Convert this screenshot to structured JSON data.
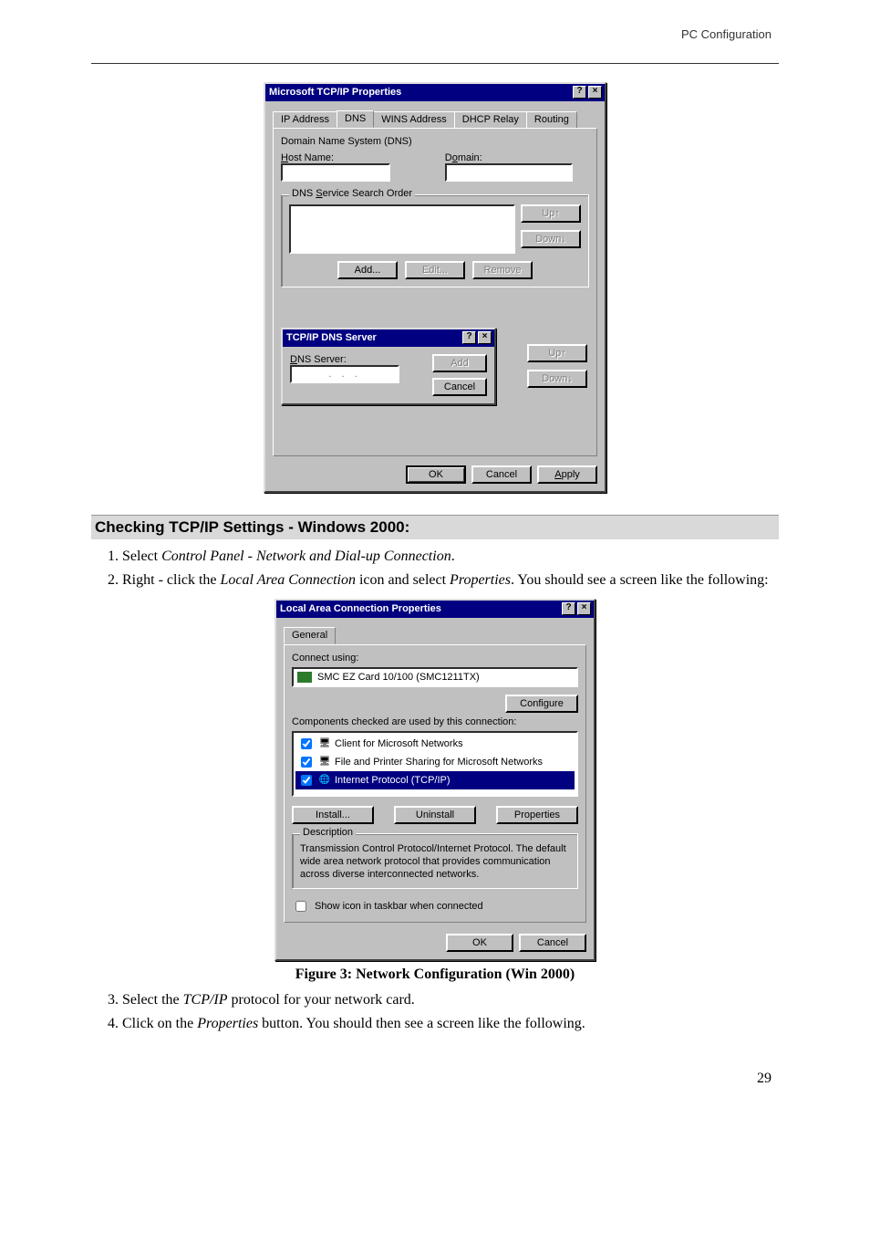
{
  "header_right": "PC Configuration",
  "dlg1": {
    "title": "Microsoft TCP/IP Properties",
    "help_btn": "?",
    "close_btn": "×",
    "tabs": [
      "IP Address",
      "DNS",
      "WINS Address",
      "DHCP Relay",
      "Routing"
    ],
    "active_tab": "DNS",
    "dns_group_label": "Domain Name System (DNS)",
    "host_label": "Host Name:",
    "domain_label": "Domain:",
    "search_order_label": "DNS Service Search Order",
    "btn_up": "Up↑",
    "btn_down": "Down↓",
    "btn_add": "Add...",
    "btn_edit": "Edit...",
    "btn_remove": "Remove",
    "sub_dialog": {
      "title": "TCP/IP DNS Server",
      "help_btn": "?",
      "close_btn": "×",
      "dns_server_label": "DNS Server:",
      "ip_placeholder": ". . .",
      "btn_add": "Add",
      "btn_cancel": "Cancel"
    },
    "btn_up2": "Up↑",
    "btn_down2": "Down↓",
    "btn_ok": "OK",
    "btn_cancel": "Cancel",
    "btn_apply": "Apply"
  },
  "section_heading": "Checking TCP/IP Settings - Windows 2000:",
  "step1_pre": "Select ",
  "step1_it": "Control Panel - Network and Dial-up Connection",
  "step1_post": ".",
  "step2_pre": "Right - click the ",
  "step2_it": "Local Area Connection",
  "step2_mid": " icon and select ",
  "step2_it2": "Properties",
  "step2_post": ". You should see a screen like the following:",
  "dlg2": {
    "title": "Local Area Connection Properties",
    "help_btn": "?",
    "close_btn": "×",
    "tab_general": "General",
    "connect_using": "Connect using:",
    "adapter": "SMC EZ Card 10/100 (SMC1211TX)",
    "btn_configure": "Configure",
    "components_label": "Components checked are used by this connection:",
    "items": [
      "Client for Microsoft Networks",
      "File and Printer Sharing for Microsoft Networks",
      "Internet Protocol (TCP/IP)"
    ],
    "btn_install": "Install...",
    "btn_uninstall": "Uninstall",
    "btn_properties": "Properties",
    "desc_group": "Description",
    "desc_text": "Transmission Control Protocol/Internet Protocol. The default wide area network protocol that provides communication across diverse interconnected networks.",
    "show_icon": "Show icon in taskbar when connected",
    "btn_ok": "OK",
    "btn_cancel": "Cancel"
  },
  "figure_caption": "Figure 3: Network Configuration (Win 2000)",
  "step3_pre": "Select the ",
  "step3_it": "TCP/IP",
  "step3_post": " protocol for your network card.",
  "step4_pre": "Click on the ",
  "step4_it": "Properties",
  "step4_post": " button. You should then see a screen like the following.",
  "page_number": "29"
}
